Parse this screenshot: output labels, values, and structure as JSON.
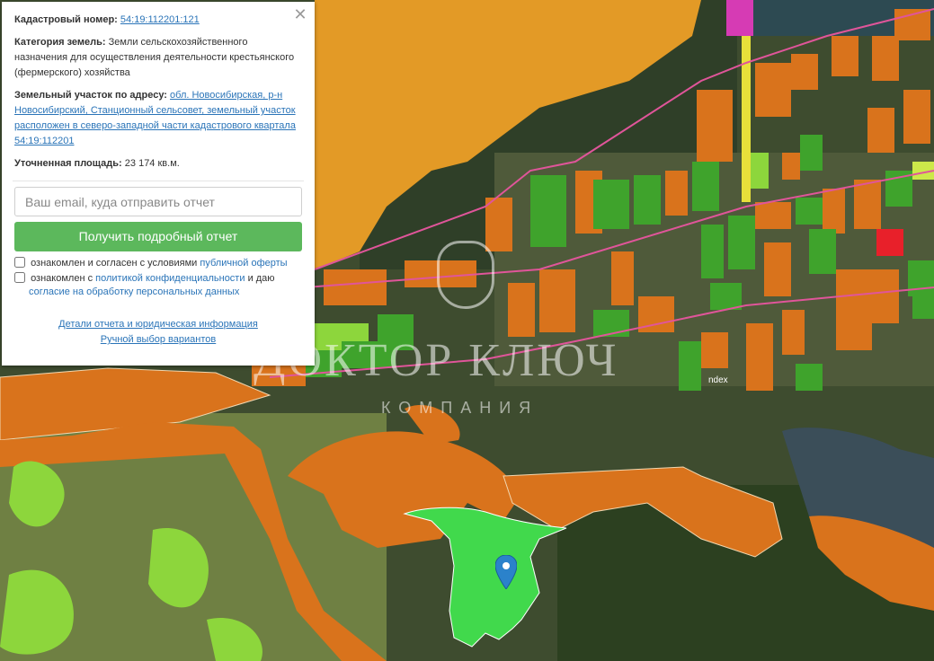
{
  "colors": {
    "orange_dark": "#d9731c",
    "orange_light": "#e39a26",
    "green_selected": "#41d94c",
    "green_light": "#8dd63c",
    "green_dark": "#3fa32c",
    "pink_line": "#e0559a",
    "red_parcel": "#e8202a",
    "button_green": "#5cb85c",
    "link_blue": "#2a74b8"
  },
  "info_panel": {
    "cadastral_label": "Кадастровый номер:",
    "cadastral_value": "54:19:112201:121",
    "category_label": "Категория земель:",
    "category_value": "Земли сельскохозяйственного назначения для осуществления деятельности крестьянского (фермерского) хозяйства",
    "address_label": "Земельный участок по адресу:",
    "address_value": "обл. Новосибирская, р-н Новосибирский, Станционный сельсовет, земельный участок расположен в северо-западной части кадастрового квартала 54:19:112201",
    "area_label": "Уточненная площадь:",
    "area_value": "23 174 кв.м.",
    "email_placeholder": "Ваш email, куда отправить отчет",
    "submit_label": "Получить подробный отчет",
    "consent1_text": "ознакомлен и согласен с условиями",
    "consent1_link": "публичной оферты",
    "consent2_text": "ознакомлен с",
    "consent2_link": "политикой конфиденциальности",
    "consent2_mid": "и даю",
    "consent2_link2": "согласие на обработку персональных данных",
    "details_link": "Детали отчета и юридическая информация",
    "manual_link": "Ручной выбор вариантов",
    "close_icon": "close-icon"
  },
  "watermark": {
    "brand": "ДОКТОР КЛЮЧ",
    "subtitle": "КОМПАНИЯ"
  },
  "map_labels": {
    "yandex": "ndex"
  },
  "icons": {
    "marker": "map-pin-icon",
    "close": "close-icon"
  }
}
